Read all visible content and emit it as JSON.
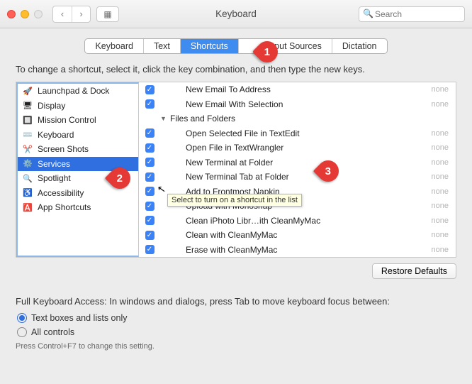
{
  "window": {
    "title": "Keyboard",
    "search_placeholder": "Search"
  },
  "tabs": [
    "Keyboard",
    "Text",
    "Shortcuts",
    "Input Sources",
    "Dictation"
  ],
  "tabs_selected": 2,
  "desc": "To change a shortcut, select it, click the key combination, and then type the new keys.",
  "categories": [
    {
      "icon": "🚀",
      "label": "Launchpad & Dock"
    },
    {
      "icon": "🖥",
      "label": "Display"
    },
    {
      "icon": "🔲",
      "label": "Mission Control"
    },
    {
      "icon": "⌨️",
      "label": "Keyboard"
    },
    {
      "icon": "✂️",
      "label": "Screen Shots"
    },
    {
      "icon": "⚙️",
      "label": "Services",
      "selected": true
    },
    {
      "icon": "🔍",
      "label": "Spotlight"
    },
    {
      "icon": "♿️",
      "label": "Accessibility"
    },
    {
      "icon": "🅰️",
      "label": "App Shortcuts"
    }
  ],
  "shortcuts": [
    {
      "checked": true,
      "group": false,
      "label": "New Email To Address",
      "val": "none"
    },
    {
      "checked": true,
      "group": false,
      "label": "New Email With Selection",
      "val": "none"
    },
    {
      "checked": false,
      "group": true,
      "label": "Files and Folders",
      "val": ""
    },
    {
      "checked": true,
      "group": false,
      "label": "Open Selected File in TextEdit",
      "val": "none"
    },
    {
      "checked": true,
      "group": false,
      "label": "Open File in TextWrangler",
      "val": "none"
    },
    {
      "checked": true,
      "group": false,
      "label": "New Terminal at Folder",
      "val": "none"
    },
    {
      "checked": true,
      "group": false,
      "label": "New Terminal Tab at Folder",
      "val": "none"
    },
    {
      "checked": true,
      "group": false,
      "label": "Add to Frontmost Napkin",
      "val": "none"
    },
    {
      "checked": true,
      "group": false,
      "label": "Upload with Monosnap",
      "val": "none"
    },
    {
      "checked": true,
      "group": false,
      "label": "Clean iPhoto Libr…ith CleanMyMac",
      "val": "none"
    },
    {
      "checked": true,
      "group": false,
      "label": "Clean with CleanMyMac",
      "val": "none"
    },
    {
      "checked": true,
      "group": false,
      "label": "Erase with CleanMyMac",
      "val": "none"
    }
  ],
  "tooltip": "Select to turn on a shortcut in the list",
  "restore": "Restore Defaults",
  "fullkb": {
    "label": "Full Keyboard Access: In windows and dialogs, press Tab to move keyboard focus between:",
    "opt1": "Text boxes and lists only",
    "opt2": "All controls",
    "hint": "Press Control+F7 to change this setting."
  },
  "callouts": {
    "1": "1",
    "2": "2",
    "3": "3"
  }
}
